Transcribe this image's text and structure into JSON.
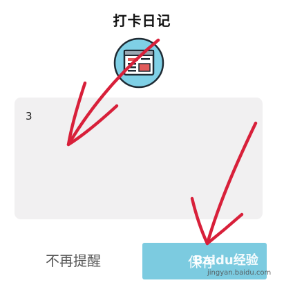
{
  "dialog": {
    "title": "打卡日记",
    "note_text": "3",
    "dismiss_label": "不再提醒",
    "save_label": "保存"
  },
  "icons": {
    "badge": "newspaper-icon"
  },
  "watermark": {
    "brand": "Baidu经验",
    "url": "jingyan.baidu.com"
  },
  "colors": {
    "accent": "#7ccbe0",
    "badge_bg": "#7fd0e6",
    "note_bg": "#f1f0f1",
    "annotation": "#d8203a"
  }
}
